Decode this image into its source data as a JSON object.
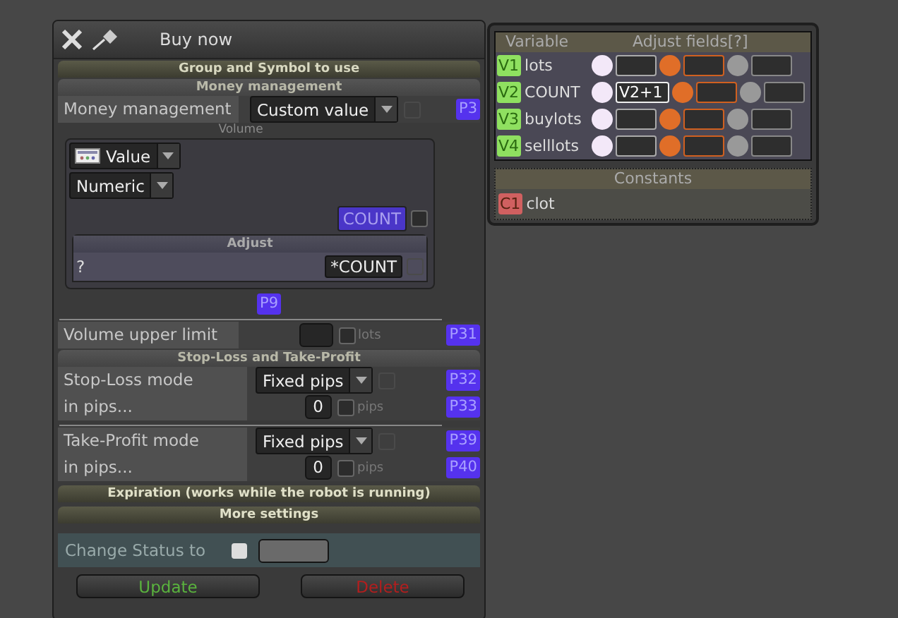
{
  "dialog": {
    "title": "Buy now"
  },
  "group_header": "Group and Symbol to use",
  "money": {
    "header": "Money management",
    "label": "Money management",
    "value": "Custom value",
    "value_box": {
      "checked": false,
      "disabled": true
    },
    "tag": "P3",
    "volume_label": "Volume",
    "source": "Value",
    "type": "Numeric",
    "variable": "COUNT",
    "variable_checked": false,
    "adjust_header": "Adjust",
    "adjust_text": "?",
    "adjust_value": "*COUNT",
    "adjust_box": {
      "checked": false,
      "disabled": true
    },
    "footer_tag": "P9"
  },
  "volume_limit": {
    "label": "Volume upper limit",
    "checked": false,
    "unit": "lots",
    "tag": "P31"
  },
  "sltp": {
    "header": "Stop-Loss and Take-Profit",
    "groups": [
      {
        "mode_label": "Stop-Loss mode",
        "mode": "Fixed pips",
        "mode_box": {
          "checked": false,
          "disabled": true
        },
        "mode_tag": "P32",
        "pips_label": "in pips...",
        "pips_value": "0",
        "checked": false,
        "unit": "pips",
        "pips_tag": "P33"
      },
      {
        "mode_label": "Take-Profit mode",
        "mode": "Fixed pips",
        "mode_box": {
          "checked": false,
          "disabled": true
        },
        "mode_tag": "P39",
        "pips_label": "in pips...",
        "pips_value": "0",
        "checked": false,
        "unit": "pips",
        "pips_tag": "P40"
      }
    ]
  },
  "collapsed_sections": [
    "Expiration (works while the robot is running)",
    "More settings"
  ],
  "status": {
    "label": "Change Status to",
    "checked": false
  },
  "buttons": [
    {
      "label": "Update",
      "kind": "update"
    },
    {
      "label": "Delete",
      "kind": "delete"
    }
  ],
  "variables": {
    "columns": [
      "Variable",
      "Adjust fields[?]"
    ],
    "rows": [
      {
        "tag": "V1",
        "name": "lots"
      },
      {
        "tag": "V2",
        "name": "COUNT",
        "value": "V2+1"
      },
      {
        "tag": "V3",
        "name": "buylots"
      },
      {
        "tag": "V4",
        "name": "selllots"
      }
    ]
  },
  "constants": {
    "header": "Constants",
    "items": [
      {
        "tag": "C1",
        "name": "clot"
      }
    ]
  }
}
